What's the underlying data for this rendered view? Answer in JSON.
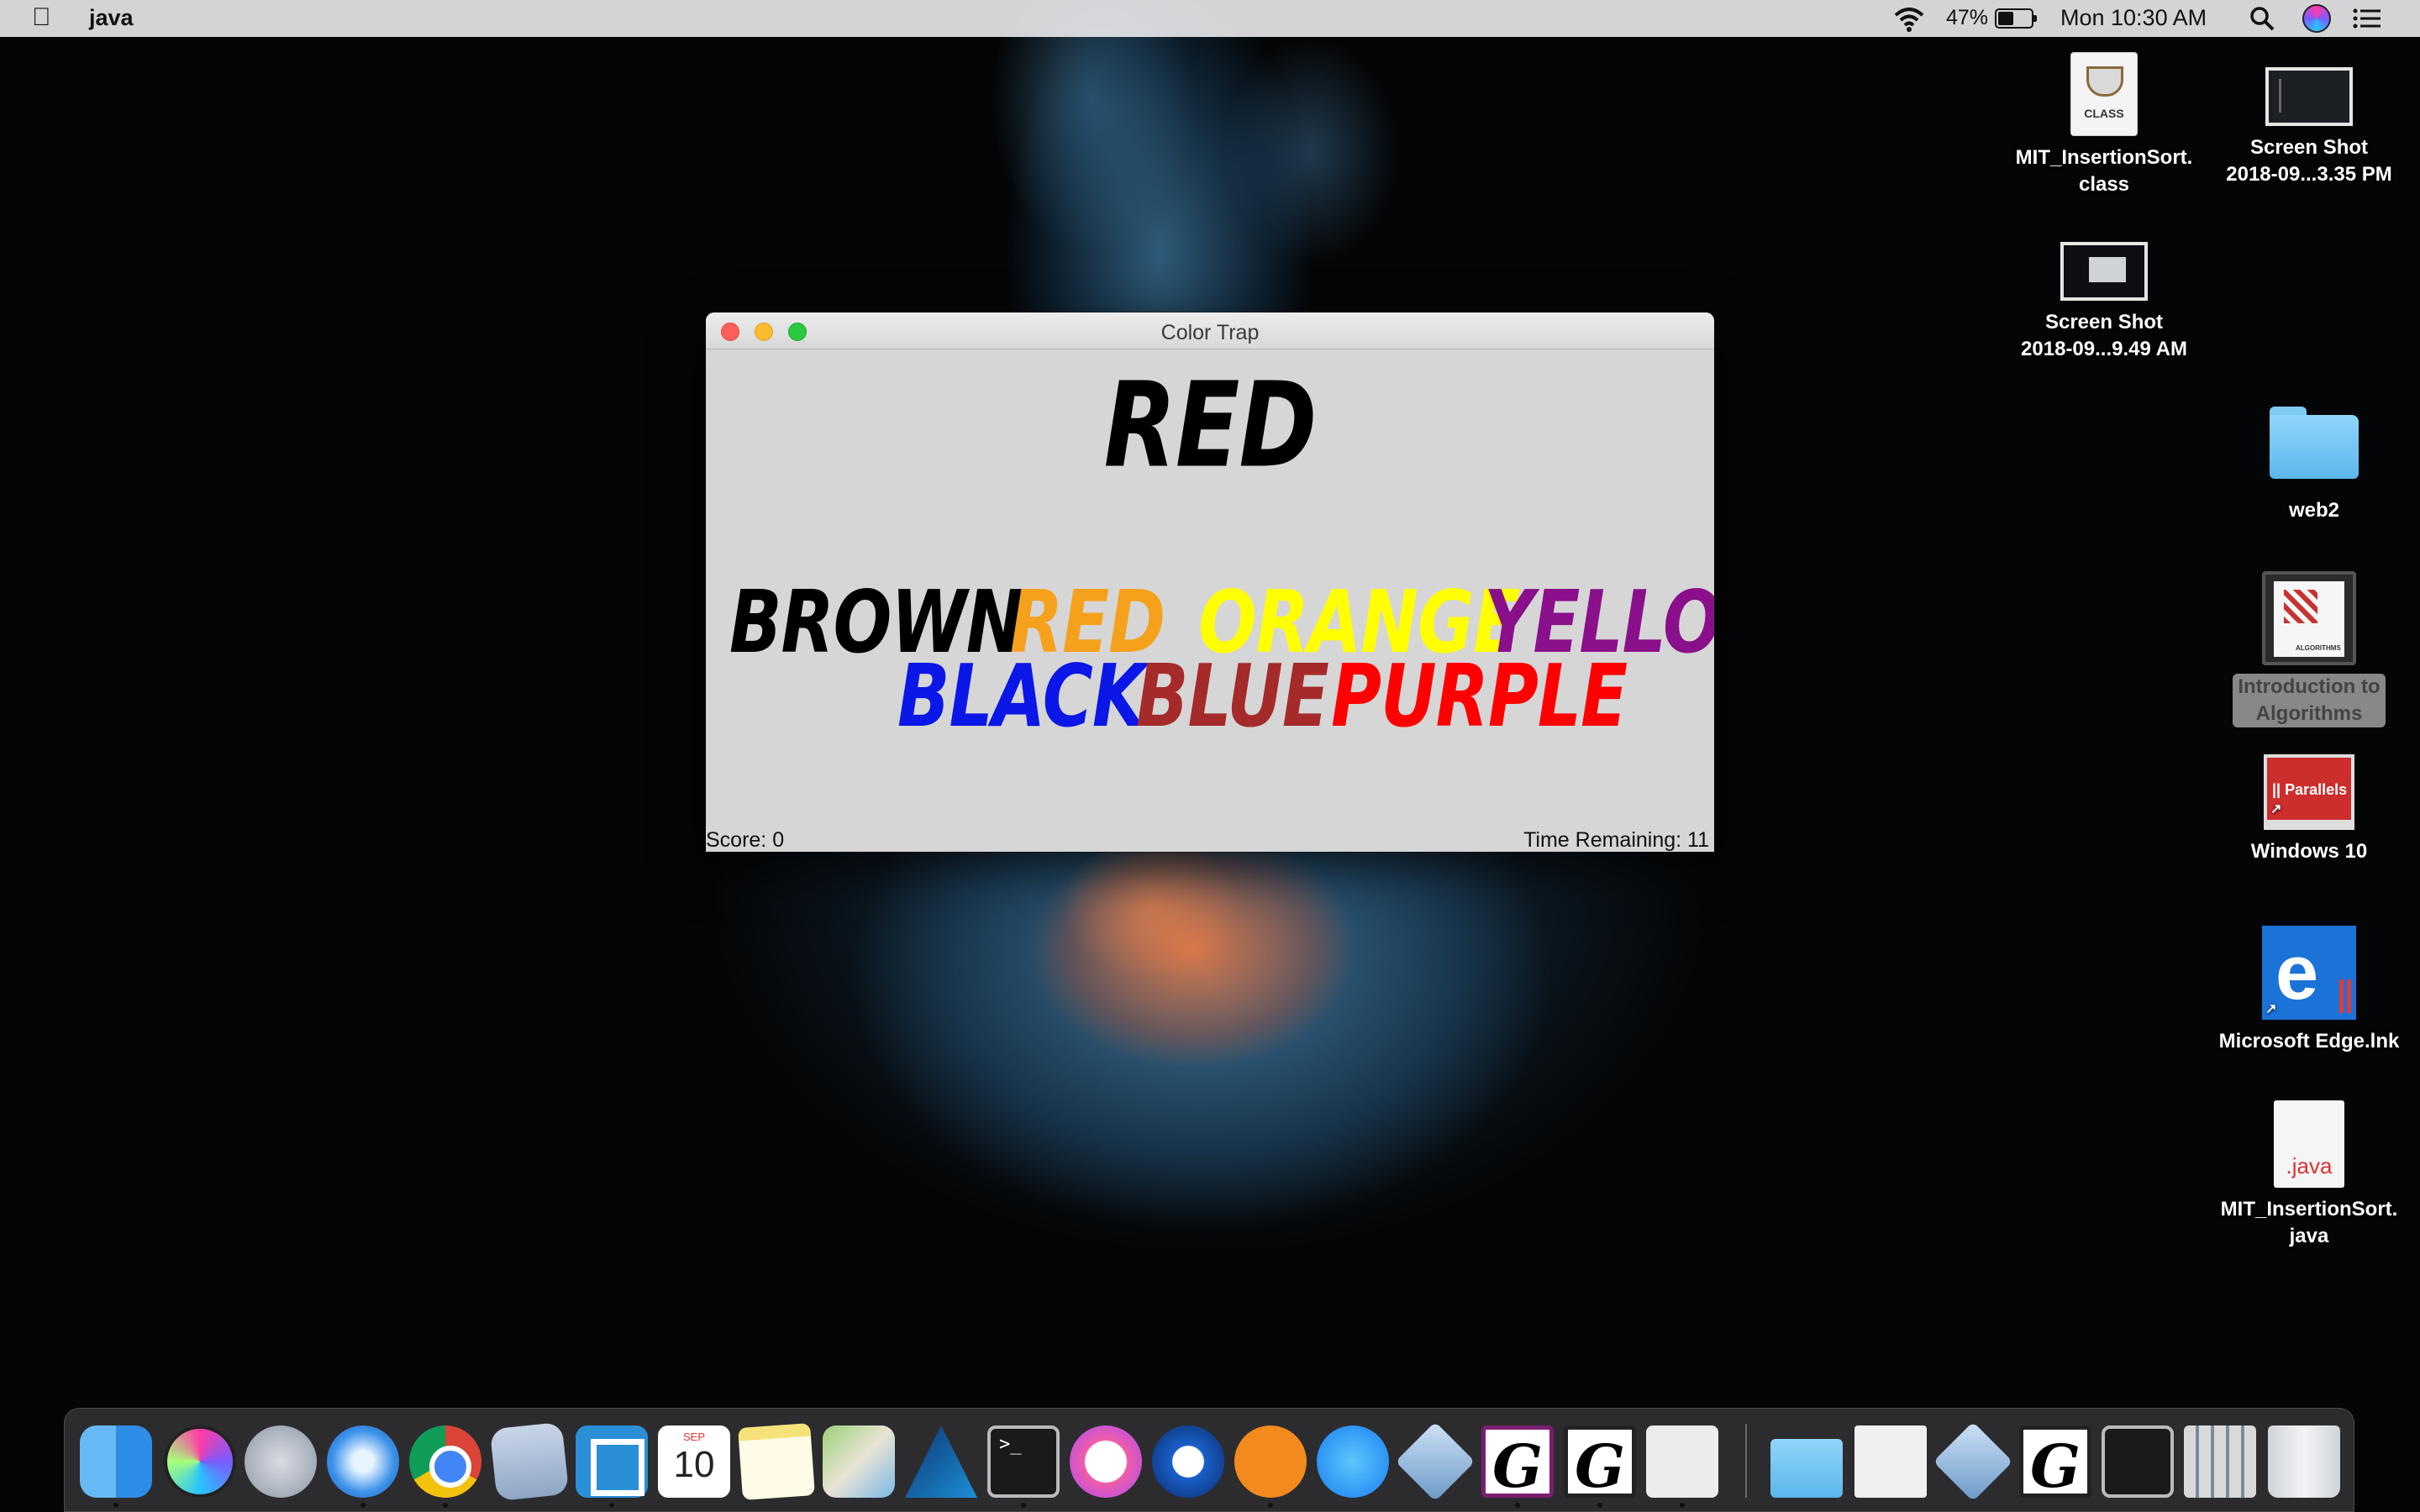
{
  "menubar": {
    "app_name": "java",
    "battery_percent": "47%",
    "battery_level": 0.47,
    "clock": "Mon 10:30 AM",
    "icons": [
      "apple-icon",
      "wifi-icon",
      "battery-icon",
      "search-icon",
      "siri-icon",
      "notification-center-icon"
    ]
  },
  "desktop_icons": [
    {
      "name": "MIT_InsertionSort.",
      "name2": "class",
      "tag": "CLASS"
    },
    {
      "name": "Screen Shot",
      "name2": "2018-09...3.35 PM"
    },
    {
      "name": "Screen Shot",
      "name2": "2018-09...9.49 AM"
    },
    {
      "name": "web2"
    },
    {
      "name": "Introduction to",
      "name2": "Algorithms",
      "cover_text": "ALGORITHMS"
    },
    {
      "name": "Windows 10",
      "badge": "|| Parallels"
    },
    {
      "name": "Microsoft Edge.lnk"
    },
    {
      "name": "MIT_InsertionSort.",
      "name2": "java",
      "ext": ".java"
    }
  ],
  "window": {
    "title": "Color Trap",
    "target_word": "RED",
    "target_color": "#000000",
    "choices": [
      {
        "word": "BROWN",
        "color": "#000000"
      },
      {
        "word": "RED",
        "color": "#f5a11c"
      },
      {
        "word": "ORANGE",
        "color": "#ffff00"
      },
      {
        "word": "YELLOW",
        "color": "#8a0f8a"
      },
      {
        "word": "BLACK",
        "color": "#0a17e6"
      },
      {
        "word": "BLUE",
        "color": "#a52a2a"
      },
      {
        "word": "PURPLE",
        "color": "#ff0000"
      }
    ],
    "score_text": "Score: 0",
    "time_text": "Time Remaining: 11"
  },
  "dock": {
    "calendar_month": "SEP",
    "calendar_day": "10",
    "terminal_prompt": ">_",
    "g_letter": "G",
    "items": [
      "finder-icon",
      "siri-icon",
      "launchpad-icon",
      "safari-icon",
      "chrome-icon",
      "mail-icon",
      "brackets-icon",
      "calendar-icon",
      "notes-icon",
      "maps-icon",
      "affinity-designer-icon",
      "terminal-icon",
      "itunes-icon",
      "quicktime-icon",
      "books-icon",
      "app-store-icon",
      "virtualbox-icon",
      "g-app-icon",
      "g-app-icon",
      "java-app-icon",
      "folder-icon",
      "document-icon",
      "virtualbox-icon",
      "g-app-icon",
      "screenshot-icon",
      "stack-icon",
      "trash-icon"
    ]
  }
}
